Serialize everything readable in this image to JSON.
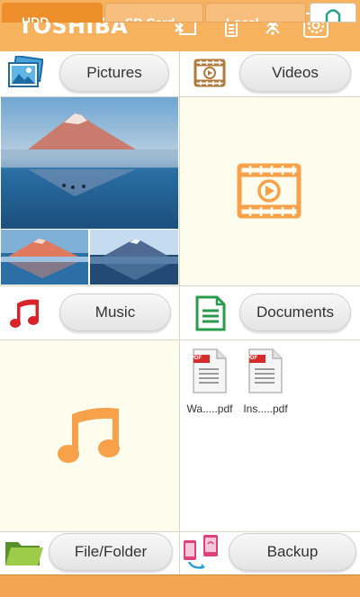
{
  "header": {
    "brand": "TOSHIBA",
    "icons": [
      "sd-card-icon",
      "battery-icon",
      "wireless-off-icon",
      "settings-icon"
    ]
  },
  "sections": {
    "pictures": {
      "label": "Pictures",
      "icon": "pictures-icon"
    },
    "videos": {
      "label": "Videos",
      "icon": "video-icon"
    },
    "music": {
      "label": "Music",
      "icon": "music-note-icon"
    },
    "documents": {
      "label": "Documents",
      "icon": "document-icon"
    },
    "file_folder": {
      "label": "File/Folder",
      "icon": "folder-icon"
    },
    "backup": {
      "label": "Backup",
      "icon": "backup-phones-icon"
    }
  },
  "documents": {
    "files": [
      {
        "badge": "PDF",
        "name": "Wa.....pdf"
      },
      {
        "badge": "PDF",
        "name": "Ins.....pdf"
      }
    ]
  },
  "tabs": [
    {
      "label": "HDD",
      "active": true
    },
    {
      "label": "SD Card",
      "active": false
    },
    {
      "label": "Local",
      "active": false
    }
  ],
  "colors": {
    "header": "#f7b25f",
    "panel": "#fefcec",
    "accent_orange": "#f7a24b",
    "music_red": "#d9232a",
    "document_green": "#2a9b4e"
  }
}
